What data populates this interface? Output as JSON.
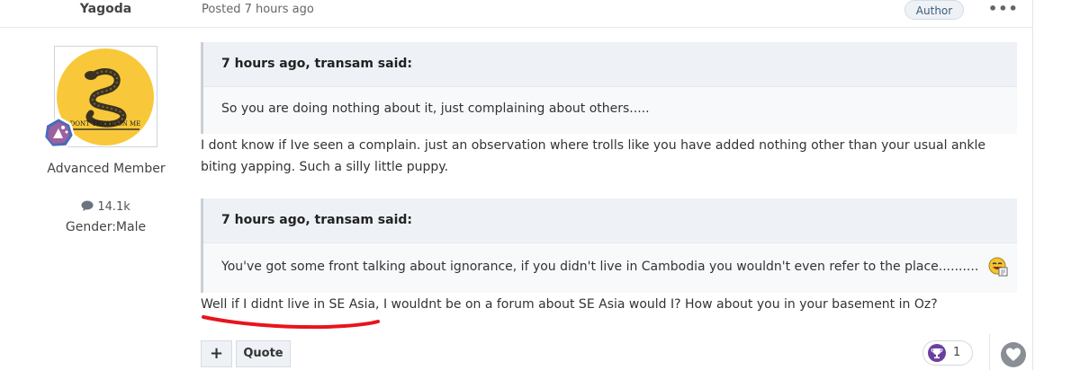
{
  "header": {
    "author_name": "Yagoda",
    "posted": "Posted 7 hours ago",
    "author_badge": "Author",
    "more_label": "•••"
  },
  "author": {
    "avatar_text": "DONT TREAD ON ME",
    "member_title": "Advanced Member",
    "post_count": "14.1k",
    "gender": "Gender:Male",
    "colors": {
      "avatar_bg": "#f8c83a",
      "badge_bg": "#4a6ab8"
    }
  },
  "quotes": [
    {
      "citation": "7 hours ago, transam said:",
      "text": "So you are doing nothing about it, just complaining about others....."
    },
    {
      "citation": "7 hours ago, transam said:",
      "text": "You've got some front talking about ignorance, if you didn't live in Cambodia you wouldn't even refer to the place..........",
      "emoji": "laughing-emoji-icon"
    }
  ],
  "replies": [
    "I dont know if Ive seen a complain. just an observation where trolls like you have added nothing other than your usual ankle biting yapping. Such a silly little puppy.",
    "Well if I didnt live in SE Asia, I wouldnt be on a forum about SE Asia would I? How about you in your basement in Oz?"
  ],
  "actions": {
    "plus_label": "+",
    "quote_label": "Quote",
    "reaction_count": "1",
    "reaction_icon": "trophy-icon",
    "heart_icon": "heart-icon"
  },
  "annotation": {
    "underline_color": "#e8141c"
  }
}
